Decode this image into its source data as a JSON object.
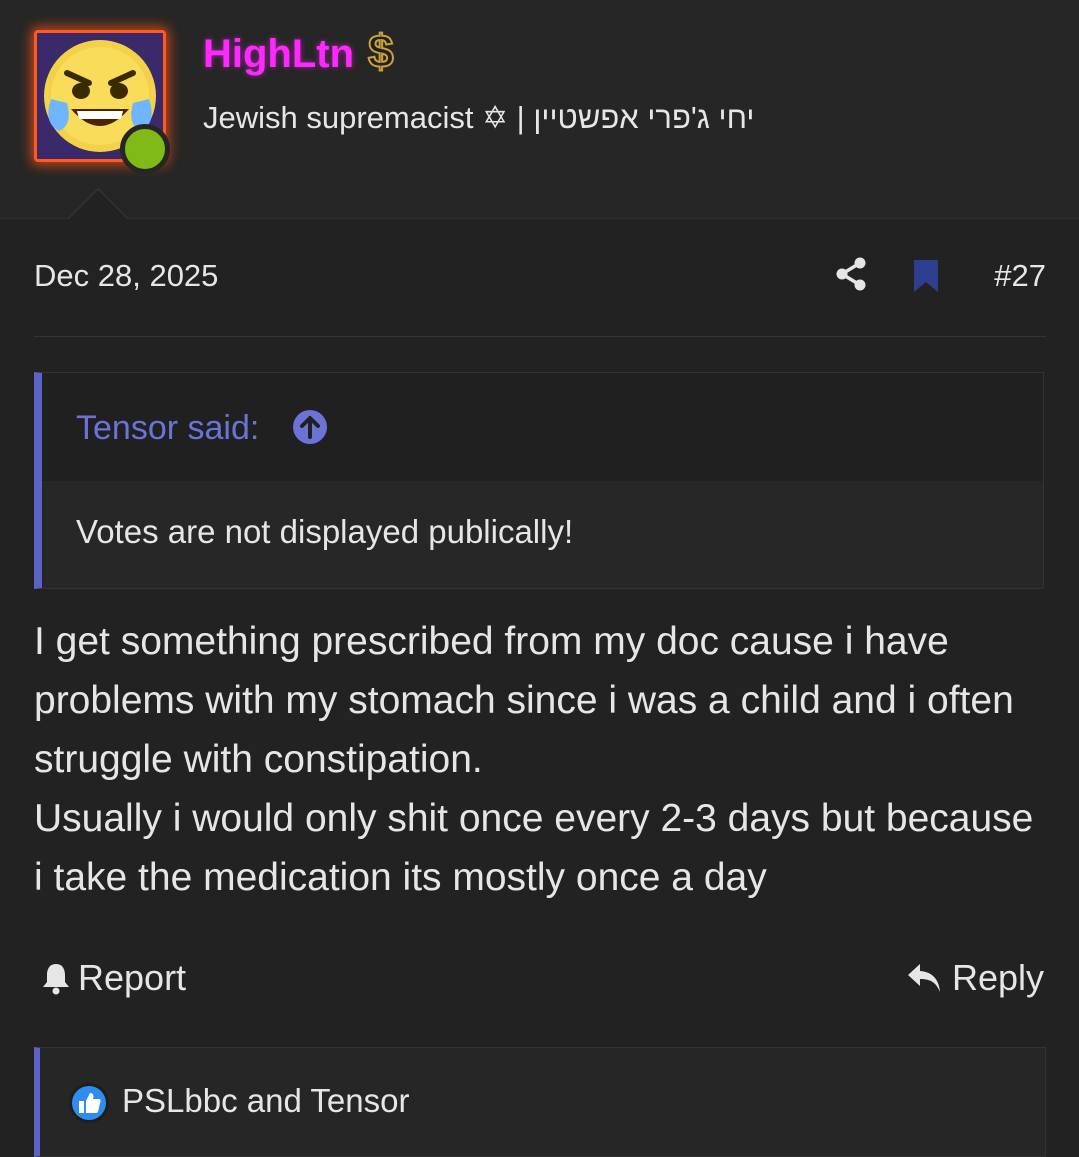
{
  "user": {
    "username": "HighLtn",
    "title": "Jewish supremacist ✡ | יחי ג'פרי אפשטיין",
    "badge_icon": "dollar-icon",
    "online": true,
    "name_color": "#ff29ff",
    "avatar_border_color": "#ff5a1f"
  },
  "post": {
    "date": "Dec 28, 2025",
    "number": "#27",
    "quote": {
      "author_label": "Tensor said:",
      "text": "Votes are not displayed publically!"
    },
    "body": [
      "I get something prescribed from my doc cause i have problems with my stomach since i was a child and i often struggle with constipation.",
      "Usually i would only shit once every 2-3 days but because i take the medication its mostly once a day"
    ]
  },
  "actions": {
    "report_label": "Report",
    "reply_label": "Reply"
  },
  "reactions": {
    "users": "PSLbbc and Tensor",
    "icon": "like-icon"
  },
  "colors": {
    "accent": "#5b63c5",
    "background": "#222222",
    "online": "#7fba18",
    "bookmark": "#2e3f8f"
  }
}
